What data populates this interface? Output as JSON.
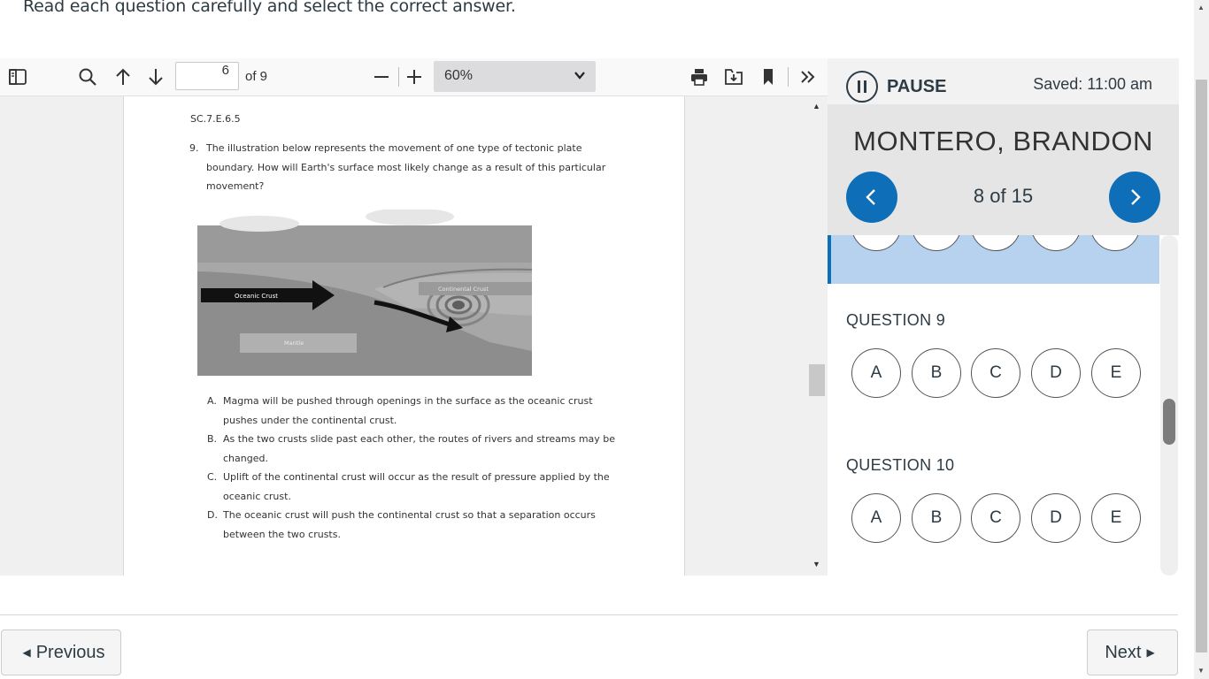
{
  "instructions": "Read each question carefully and select the correct answer.",
  "pdf_toolbar": {
    "page_value": "6",
    "page_of": "of 9",
    "zoom": "60%",
    "icons": [
      "sidebar-toggle-icon",
      "search-icon",
      "arrow-up-icon",
      "arrow-down-icon",
      "zoom-out-icon",
      "zoom-in-icon",
      "print-icon",
      "save-icon",
      "bookmark-icon",
      "more-tools-icon"
    ]
  },
  "pdf": {
    "standard_code": "SC.7.E.6.5",
    "question_number": "9.",
    "question_text": "The illustration below represents the movement of one type of tectonic plate boundary. How will Earth's surface most likely change as a result of this particular movement?",
    "illustration_labels": {
      "oceanic": "Oceanic Crust",
      "continental": "Continental Crust",
      "mantle": "Mantle"
    },
    "options": [
      {
        "letter": "A.",
        "text": "Magma will be pushed through openings in the surface as the oceanic crust pushes under the continental crust."
      },
      {
        "letter": "B.",
        "text": "As the two crusts slide past each other, the routes of rivers and streams may be changed."
      },
      {
        "letter": "C.",
        "text": "Uplift of the continental crust will occur as the result of pressure applied by the oceanic crust."
      },
      {
        "letter": "D.",
        "text": "The oceanic crust will push the continental crust so that a separation occurs between the two crusts."
      }
    ]
  },
  "right_panel": {
    "pause_label": "PAUSE",
    "saved": "Saved: 11:00 am",
    "student_name": "MONTERO, BRANDON",
    "counter": "8 of 15",
    "questions": [
      {
        "label": "QUESTION 9",
        "choices": [
          "A",
          "B",
          "C",
          "D",
          "E"
        ]
      },
      {
        "label": "QUESTION 10",
        "choices": [
          "A",
          "B",
          "C",
          "D",
          "E"
        ]
      }
    ]
  },
  "footer": {
    "previous": "Previous",
    "next": "Next"
  },
  "colors": {
    "accent": "#0e6eb8",
    "selected_band": "#b6d2ee",
    "text": "#2d3b45"
  }
}
